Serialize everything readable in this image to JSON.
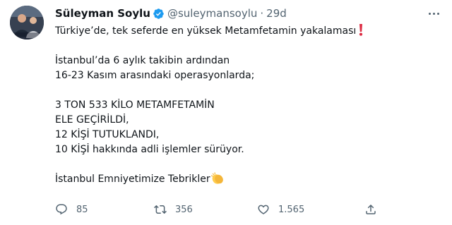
{
  "tweet": {
    "author_name": "Süleyman Soylu",
    "handle": "@suleymansoylu",
    "separator": "·",
    "time": "29d",
    "lines": [
      "Türkiye’de, tek seferde en yüksek Metamfetamin yakalaması",
      "",
      "İstanbul’da 6 aylık takibin ardından",
      "16-23 Kasım arasındaki operasyonlarda;",
      "",
      "3 TON 533 KİLO METAMFETAMİN",
      "ELE GEÇİRİLDİ,",
      "12 KİŞİ TUTUKLANDI,",
      "10 KİŞİ hakkında adli işlemler sürüyor.",
      "",
      "İstanbul Emniyetimize Tebrikler"
    ],
    "emojis": {
      "line_1": "red-exclamation-mark",
      "line_11": "clapping-hands"
    }
  },
  "actions": {
    "reply_count": "85",
    "retweet_count": "356",
    "like_count": "1.565"
  },
  "colors": {
    "verified_blue": "#1d9bf0",
    "text_primary": "#0f1419",
    "text_secondary": "#536471",
    "exclaim_red": "#dd2e44",
    "clap_yellow": "#ffcc4d"
  }
}
